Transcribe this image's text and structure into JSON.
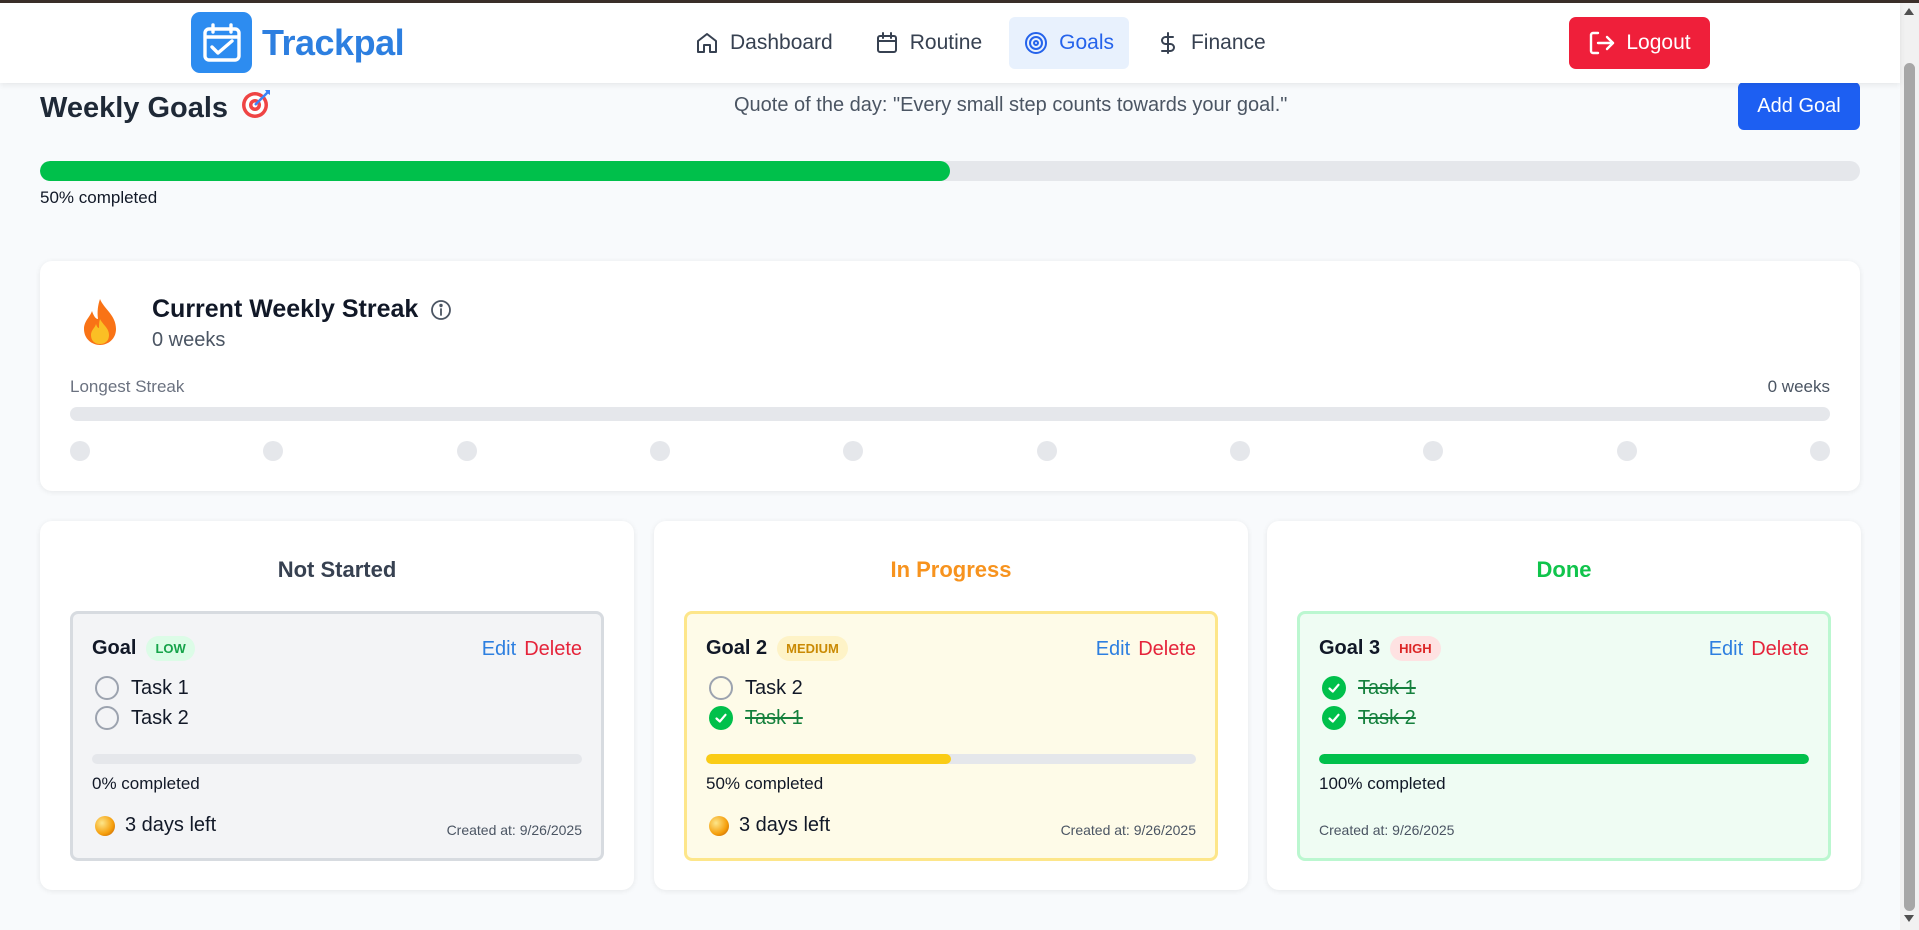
{
  "app": {
    "name": "Trackpal"
  },
  "nav": {
    "items": [
      {
        "label": "Dashboard",
        "icon": "home-icon"
      },
      {
        "label": "Routine",
        "icon": "calendar-icon"
      },
      {
        "label": "Goals",
        "icon": "target-icon",
        "active": true
      },
      {
        "label": "Finance",
        "icon": "dollar-icon"
      }
    ],
    "logout_label": "Logout"
  },
  "page": {
    "title": "Weekly Goals",
    "title_emoji": "🎯",
    "quote": "Quote of the day: \"Every small step counts towards your goal.\"",
    "add_goal_label": "Add Goal",
    "overall_progress": 0.5,
    "overall_label": "50% completed"
  },
  "streak": {
    "title": "Current Weekly Streak",
    "value": "0 weeks",
    "longest_label": "Longest Streak",
    "longest_value": "0 weeks",
    "longest_progress": 0,
    "dot_count": 10
  },
  "columns": [
    {
      "title": "Not Started",
      "title_color": "#374151",
      "goal": {
        "name": "Goal",
        "priority": "LOW",
        "tasks": [
          {
            "label": "Task 1",
            "done": false
          },
          {
            "label": "Task 2",
            "done": false
          }
        ],
        "progress": 0,
        "progress_label": "0% completed",
        "days_left": "3 days left",
        "created": "Created at: 9/26/2025"
      }
    },
    {
      "title": "In Progress",
      "title_color": "#f7931e",
      "goal": {
        "name": "Goal 2",
        "priority": "MEDIUM",
        "tasks": [
          {
            "label": "Task 2",
            "done": false
          },
          {
            "label": "Task 1",
            "done": true
          }
        ],
        "progress": 0.5,
        "progress_label": "50% completed",
        "days_left": "3 days left",
        "created": "Created at: 9/26/2025"
      }
    },
    {
      "title": "Done",
      "title_color": "#10c44c",
      "goal": {
        "name": "Goal 3",
        "priority": "HIGH",
        "tasks": [
          {
            "label": "Task 1",
            "done": true
          },
          {
            "label": "Task 2",
            "done": true
          }
        ],
        "progress": 1,
        "progress_label": "100% completed",
        "created": "Created at: 9/26/2025"
      }
    }
  ],
  "labels": {
    "edit": "Edit",
    "delete": "Delete"
  },
  "colors": {
    "accent": "#2d7fe0",
    "logout": "#ef1f3a",
    "add_goal": "#1d5ff2",
    "progress_green": "#00c04b",
    "progress_yellow": "#facc15"
  }
}
